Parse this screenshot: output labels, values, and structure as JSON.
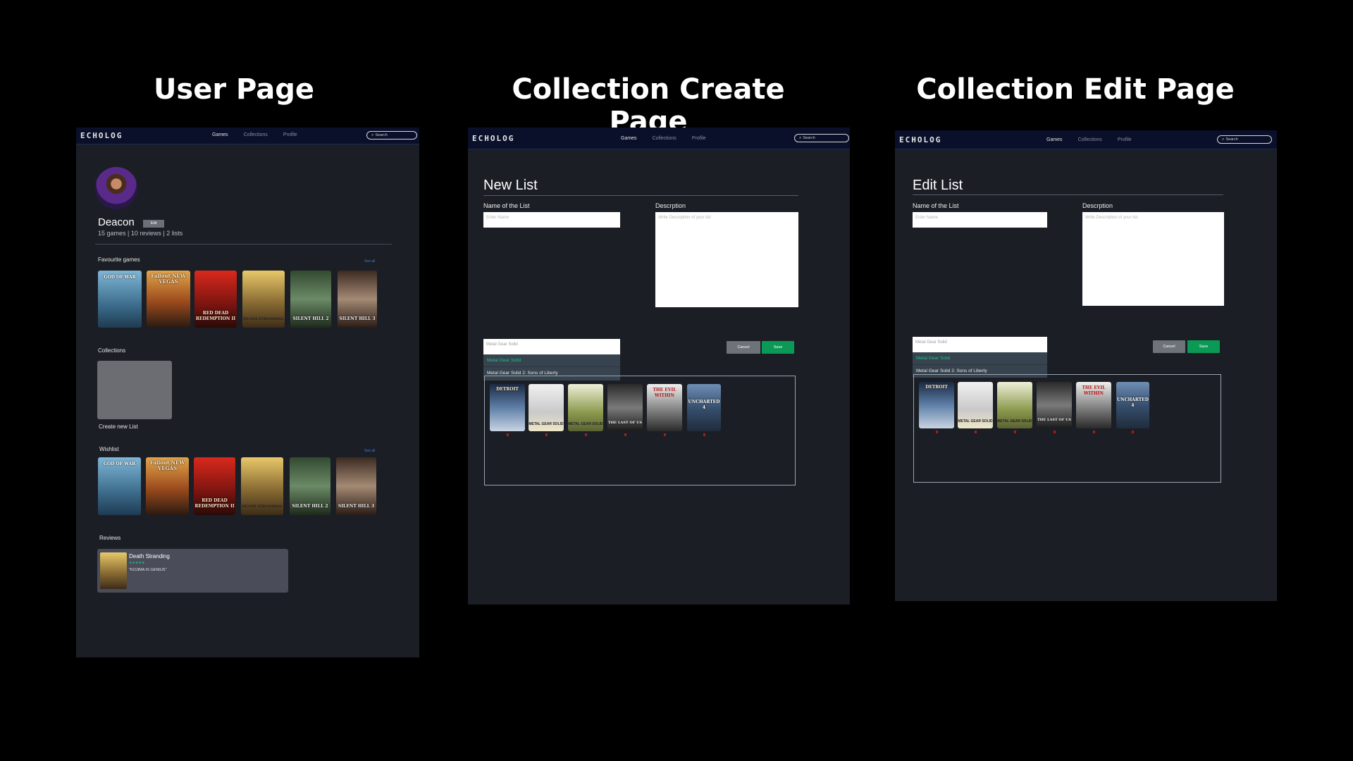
{
  "headings": {
    "user": "User Page",
    "create": "Collection Create Page",
    "edit": "Collection Edit Page"
  },
  "nav": {
    "logo": "ECHOLOG",
    "links": [
      "Games",
      "Collections",
      "Profile"
    ],
    "search_placeholder": "Search"
  },
  "user_page": {
    "username": "Deacon",
    "edit_label": "Edit",
    "stats": "15 games | 10 reviews | 2 lists",
    "favourites_title": "Favourite games",
    "see_all": "See all",
    "favourites": [
      "GOD OF WAR",
      "Fallout NEW VEGAS",
      "RED DEAD REDEMPTION II",
      "DEATH STRANDING",
      "SILENT HILL 2",
      "SILENT HILL 3"
    ],
    "collections_title": "Collections",
    "create_new_list": "Create new List",
    "wishlist_title": "Wishlist",
    "wishlist": [
      "GOD OF WAR",
      "Fallout NEW VEGAS",
      "RED DEAD REDEMPTION II",
      "DEATH STRANDING",
      "SILENT HILL 2",
      "SILENT HILL 3"
    ],
    "reviews_title": "Reviews",
    "review": {
      "game": "Death Stranding",
      "rating": "★★★★★",
      "text": "\"KOJIMA IS GENIUS\""
    }
  },
  "create_page": {
    "title": "New List",
    "name_label": "Name of the List",
    "name_placeholder": "Enter Name",
    "desc_label": "Descrption",
    "desc_placeholder": "Write Description of your list",
    "search_value": "Metal Gear Solid",
    "dropdown": [
      "Metal Gear Solid",
      "Metal Gear Solid 2: Sons of Liberty"
    ],
    "cancel": "Cancel",
    "save": "Save",
    "list_games": [
      "DETROIT",
      "METAL GEAR SOLID",
      "METAL GEAR SOLID",
      "THE LAST OF US",
      "THE EVIL WITHIN",
      "UNCHARTED 4"
    ]
  },
  "edit_page": {
    "title": "Edit List",
    "name_label": "Name of the List",
    "name_placeholder": "Enter Name",
    "desc_label": "Descrption",
    "desc_placeholder": "Write Description of your list",
    "search_value": "Metal Gear Solid",
    "dropdown": [
      "Metal Gear Solid",
      "Metal Gear Solid 2: Sons of Liberty"
    ],
    "cancel": "Cancel",
    "save": "Save",
    "list_games": [
      "DETROIT",
      "METAL GEAR SOLID",
      "METAL GEAR SOLID",
      "THE LAST OF US",
      "THE EVIL WITHIN",
      "UNCHARTED 4"
    ]
  },
  "colors": {
    "panel_bg": "#1b1f25",
    "nav_bg": "#0a1029",
    "save_green": "#0b9a55",
    "dropdown_bg": "#37434f",
    "active_item": "#1ec083",
    "review_card": "#4a4d59"
  }
}
